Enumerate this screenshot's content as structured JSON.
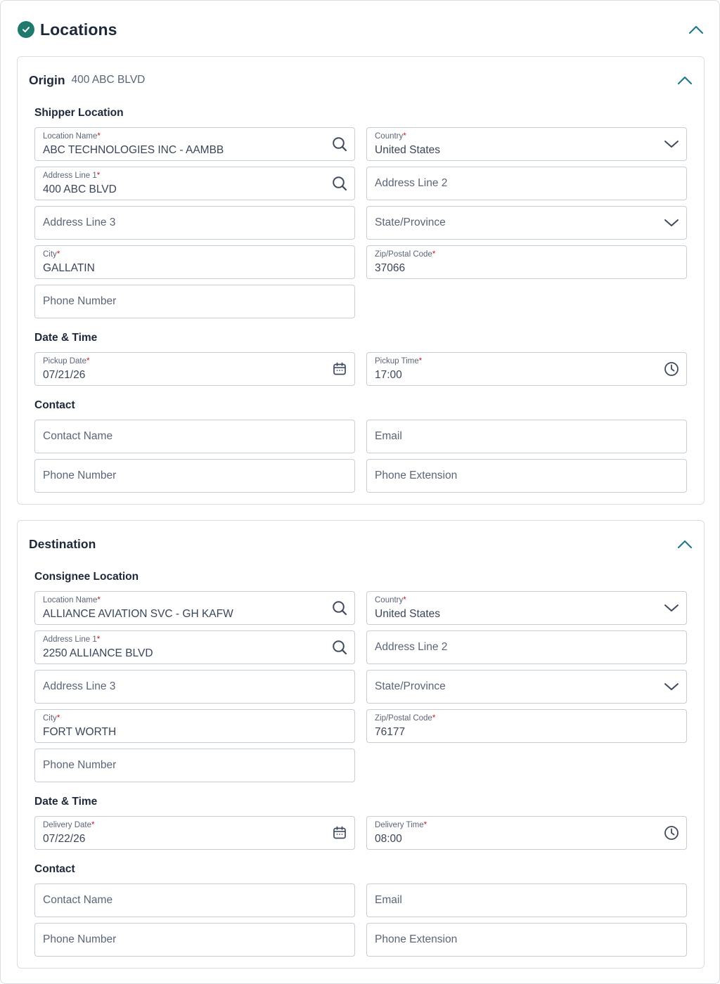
{
  "header": {
    "title": "Locations"
  },
  "origin": {
    "title": "Origin",
    "subtitle": "400 ABC BLVD",
    "location_section": "Shipper Location",
    "location_name": {
      "label": "Location Name",
      "value": "ABC TECHNOLOGIES INC - AAMBB"
    },
    "country": {
      "label": "Country",
      "value": "United States"
    },
    "address1": {
      "label": "Address Line 1",
      "value": "400 ABC BLVD"
    },
    "address2": {
      "placeholder": "Address Line 2"
    },
    "address3": {
      "placeholder": "Address Line 3"
    },
    "state": {
      "placeholder": "State/Province"
    },
    "city": {
      "label": "City",
      "value": "GALLATIN"
    },
    "zip": {
      "label": "Zip/Postal Code",
      "value": "37066"
    },
    "phone": {
      "placeholder": "Phone Number"
    },
    "datetime_section": "Date & Time",
    "date": {
      "label": "Pickup Date",
      "value": "07/21/26"
    },
    "time": {
      "label": "Pickup Time",
      "value": "17:00"
    },
    "contact_section": "Contact",
    "contact_name": {
      "placeholder": "Contact Name"
    },
    "email": {
      "placeholder": "Email"
    },
    "contact_phone": {
      "placeholder": "Phone Number"
    },
    "phone_ext": {
      "placeholder": "Phone Extension"
    }
  },
  "destination": {
    "title": "Destination",
    "location_section": "Consignee Location",
    "location_name": {
      "label": "Location Name",
      "value": "ALLIANCE AVIATION SVC - GH KAFW"
    },
    "country": {
      "label": "Country",
      "value": "United States"
    },
    "address1": {
      "label": "Address Line 1",
      "value": "2250 ALLIANCE BLVD"
    },
    "address2": {
      "placeholder": "Address Line 2"
    },
    "address3": {
      "placeholder": "Address Line 3"
    },
    "state": {
      "placeholder": "State/Province"
    },
    "city": {
      "label": "City",
      "value": "FORT WORTH"
    },
    "zip": {
      "label": "Zip/Postal Code",
      "value": "76177"
    },
    "phone": {
      "placeholder": "Phone Number"
    },
    "datetime_section": "Date & Time",
    "date": {
      "label": "Delivery Date",
      "value": "07/22/26"
    },
    "time": {
      "label": "Delivery Time",
      "value": "08:00"
    },
    "contact_section": "Contact",
    "contact_name": {
      "placeholder": "Contact Name"
    },
    "email": {
      "placeholder": "Email"
    },
    "contact_phone": {
      "placeholder": "Phone Number"
    },
    "phone_ext": {
      "placeholder": "Phone Extension"
    }
  },
  "required_marker": "*",
  "icons": {
    "header_status": "check-circle-icon",
    "collapse": "chevron-up-icon",
    "lookup": "search-icon",
    "dropdown": "chevron-down-icon",
    "date": "calendar-icon",
    "time": "clock-icon"
  },
  "colors": {
    "accent": "#1f7a6d",
    "required": "#c01b2a",
    "border": "#c7cdd6"
  }
}
